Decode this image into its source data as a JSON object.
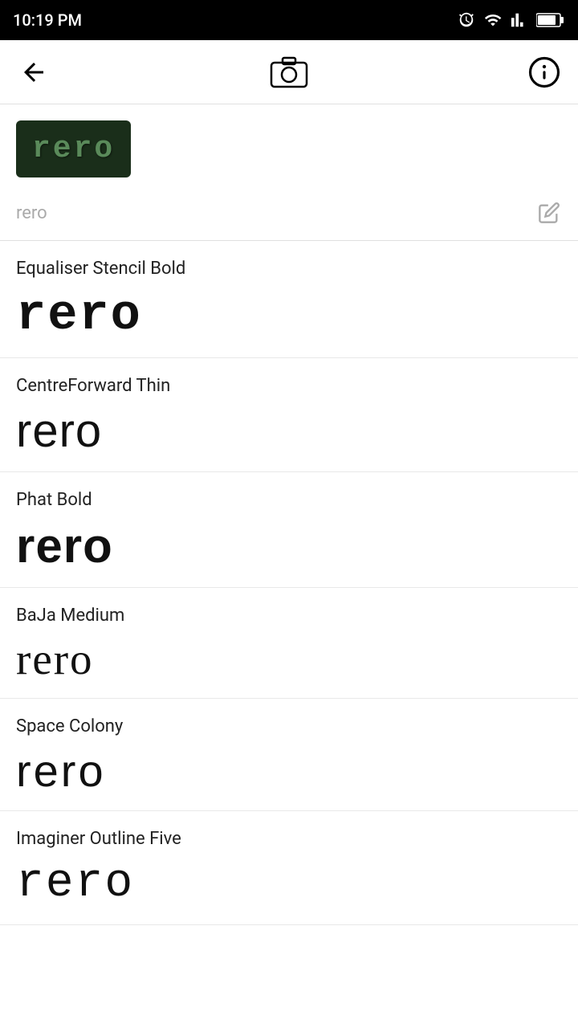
{
  "status_bar": {
    "time": "10:19 PM"
  },
  "header": {
    "back_label": "←",
    "camera_label": "camera",
    "info_label": "info"
  },
  "preview": {
    "text": "rero",
    "background_color": "#1a2e1a",
    "text_color": "#5a8a5a"
  },
  "search": {
    "placeholder": "rero",
    "edit_icon": "pencil"
  },
  "font_items": [
    {
      "name": "Equaliser Stencil Bold",
      "sample": "rero",
      "style_class": "font-equaliser"
    },
    {
      "name": "CentreForward Thin",
      "sample": "rero",
      "style_class": "font-centreforward"
    },
    {
      "name": "Phat Bold",
      "sample": "rero",
      "style_class": "font-phat"
    },
    {
      "name": "BaJa Medium",
      "sample": "rero",
      "style_class": "font-baja"
    },
    {
      "name": "Space Colony",
      "sample": "rero",
      "style_class": "font-space"
    },
    {
      "name": "Imaginer Outline Five",
      "sample": "rero",
      "style_class": "font-imaginer"
    }
  ]
}
